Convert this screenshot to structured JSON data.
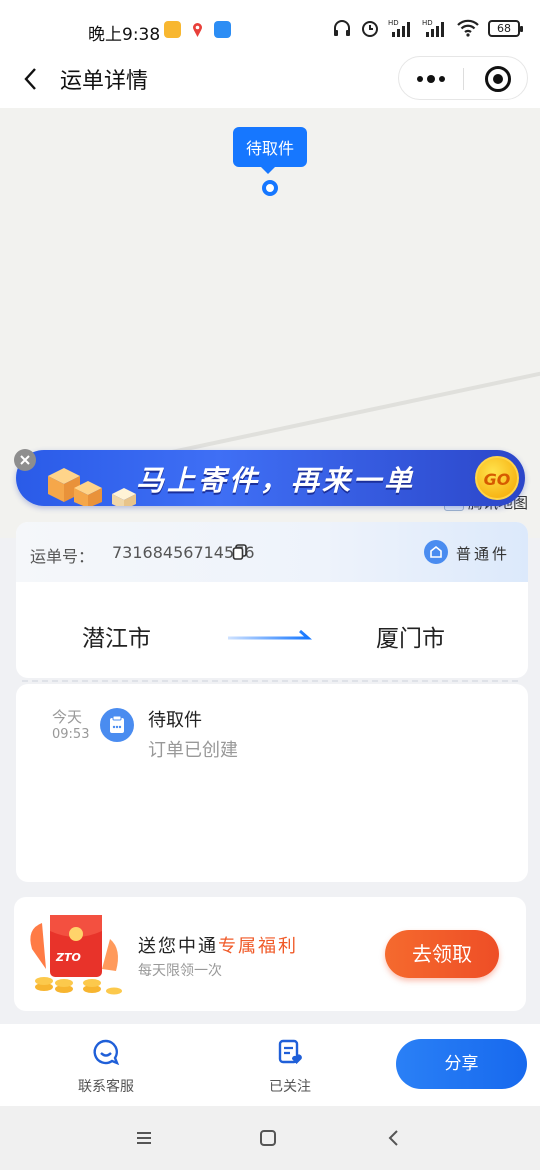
{
  "status_bar": {
    "time": "晚上9:38",
    "battery": "68"
  },
  "header": {
    "title": "运单详情"
  },
  "map": {
    "pin_label": "待取件",
    "logo": "腾讯地图"
  },
  "banner": {
    "text": "马上寄件，再来一单",
    "go": "GO"
  },
  "order": {
    "waybill_label": "运单号：",
    "waybill_no": "73168456714576",
    "service_type": "普通件",
    "from_city": "潜江市",
    "to_city": "厦门市"
  },
  "timeline": [
    {
      "day": "今天",
      "time": "09:53",
      "status": "待取件",
      "description": "订单已创建"
    }
  ],
  "welfare": {
    "title_prefix": "送您中通",
    "title_highlight": "专属福利",
    "subtitle": "每天限领一次",
    "claim_button": "去领取",
    "image_text": "ZTO"
  },
  "bottom_bar": {
    "service_label": "联系客服",
    "follow_label": "已关注",
    "share_label": "分享"
  },
  "colors": {
    "brand_blue": "#1677ff",
    "claim_orange": "#f05a28",
    "highlight": "#f05a28"
  }
}
